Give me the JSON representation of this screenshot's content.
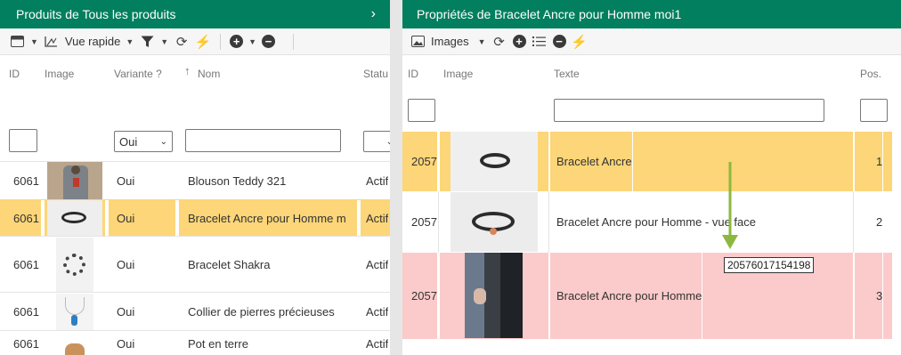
{
  "left": {
    "title": "Produits de Tous les produits",
    "chevron": "›",
    "toolbar": {
      "view_label": "Vue rapide"
    },
    "columns": {
      "id": "ID",
      "image": "Image",
      "variante": "Variante ?",
      "sort_arrow": "↑",
      "nom": "Nom",
      "statut": "Statu"
    },
    "filter_variante": "Oui",
    "rows": [
      {
        "id": "6061",
        "variante": "Oui",
        "nom": "Blouson Teddy 321",
        "statut": "Actif"
      },
      {
        "id": "6061",
        "variante": "Oui",
        "nom": "Bracelet Ancre pour Homme m",
        "statut": "Actif"
      },
      {
        "id": "6061",
        "variante": "Oui",
        "nom": "Bracelet Shakra",
        "statut": "Actif"
      },
      {
        "id": "6061",
        "variante": "Oui",
        "nom": "Collier de pierres précieuses",
        "statut": "Actif"
      },
      {
        "id": "6061",
        "variante": "Oui",
        "nom": "Pot en terre",
        "statut": "Actif"
      }
    ]
  },
  "right": {
    "title": "Propriétés de Bracelet Ancre pour Homme moi1",
    "toolbar": {
      "images_label": "Images"
    },
    "columns": {
      "id": "ID",
      "image": "Image",
      "texte": "Texte",
      "pos": "Pos."
    },
    "rows": [
      {
        "id": "2057",
        "texte": "Bracelet Ancre",
        "pos": "1"
      },
      {
        "id": "2057",
        "texte": "Bracelet Ancre pour Homme - vue face",
        "pos": "2"
      },
      {
        "id": "2057",
        "texte": "Bracelet Ancre pour Homme",
        "pos": "3"
      }
    ],
    "tooltip": "20576017154198"
  },
  "colors": {
    "header": "#017f5e",
    "selected_row": "#fcd678",
    "drop_row": "#fbcaca",
    "drag_arrow": "#8db83f"
  }
}
